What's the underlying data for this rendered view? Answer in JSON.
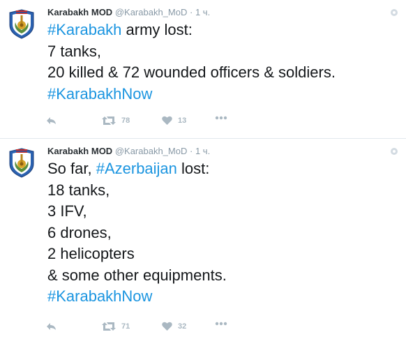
{
  "tweets": [
    {
      "author_name": "Karabakh MOD",
      "handle": "@Karabakh_MoD",
      "dot": "·",
      "time": "1 ч.",
      "lines": [
        [
          {
            "t": "#Karabakh",
            "tag": true
          },
          {
            "t": " army lost:",
            "tag": false
          }
        ],
        [
          {
            "t": "7 tanks,",
            "tag": false
          }
        ],
        [
          {
            "t": "20 killed & 72 wounded officers & soldiers.",
            "tag": false
          }
        ],
        [
          {
            "t": "#KarabakhNow",
            "tag": true
          }
        ]
      ],
      "retweets": "78",
      "likes": "13"
    },
    {
      "author_name": "Karabakh MOD",
      "handle": "@Karabakh_MoD",
      "dot": "·",
      "time": "1 ч.",
      "lines": [
        [
          {
            "t": "So far, ",
            "tag": false
          },
          {
            "t": "#Azerbaijan",
            "tag": true
          },
          {
            "t": " lost:",
            "tag": false
          }
        ],
        [
          {
            "t": "18 tanks,",
            "tag": false
          }
        ],
        [
          {
            "t": "3 IFV,",
            "tag": false
          }
        ],
        [
          {
            "t": "6 drones,",
            "tag": false
          }
        ],
        [
          {
            "t": "2 helicopters",
            "tag": false
          }
        ],
        [
          {
            "t": "& some other equipments.",
            "tag": false
          }
        ],
        [
          {
            "t": "#KarabakhNow",
            "tag": true
          }
        ]
      ],
      "retweets": "71",
      "likes": "32"
    }
  ],
  "icons": {
    "reply": "reply-icon",
    "retweet": "retweet-icon",
    "like": "heart-icon",
    "more": "more-icon",
    "settings": "gear-icon",
    "avatar": "karabakh-mod-emblem"
  },
  "colors": {
    "hashtag": "#1b95e0",
    "muted": "#8899a6",
    "icon": "#aab8c2",
    "emblem_blue": "#2b62b1",
    "emblem_gold": "#d8a42a"
  }
}
